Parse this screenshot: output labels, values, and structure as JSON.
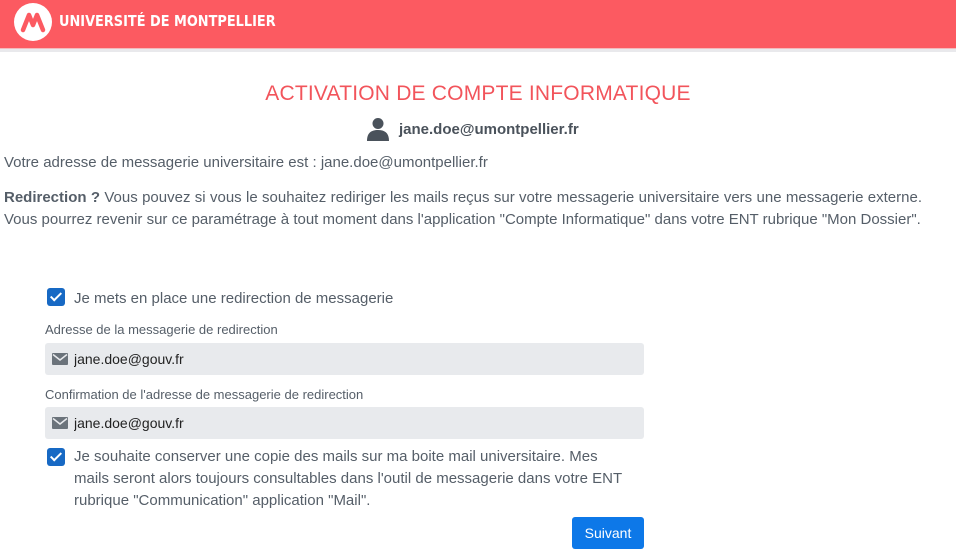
{
  "header": {
    "brand": "UNIVERSITÉ DE MONTPELLIER",
    "logo_icon": "um-logo-icon",
    "background": "#fc5a61"
  },
  "page": {
    "title": "ACTIVATION DE COMPTE INFORMATIQUE",
    "user_icon": "user-icon",
    "user_email": "jane.doe@umontpellier.fr",
    "mailbox_line": "Votre adresse de messagerie universitaire est : jane.doe@umontpellier.fr",
    "redirection_heading": "Redirection ?",
    "redirection_text": " Vous pouvez si vous le souhaitez rediriger les mails reçus sur votre messagerie universitaire vers une messagerie externe. Vous pourrez revenir sur ce paramétrage à tout moment dans l'application \"Compte Informatique\" dans votre ENT rubrique \"Mon Dossier\"."
  },
  "form": {
    "redirect_checkbox": {
      "checked": true,
      "label": "Je mets en place une redirection de messagerie"
    },
    "redirect_address": {
      "label": "Adresse de la messagerie de redirection",
      "value": "jane.doe@gouv.fr",
      "icon": "envelope-icon"
    },
    "redirect_confirm": {
      "label": "Confirmation de l'adresse de messagerie de redirection",
      "value": "jane.doe@gouv.fr",
      "icon": "envelope-icon"
    },
    "keep_copy_checkbox": {
      "checked": true,
      "label": "Je souhaite conserver une copie des mails sur ma boite mail universitaire. Mes mails seront alors toujours consultables dans l'outil de messagerie dans votre ENT rubrique \"Communication\" application \"Mail\"."
    },
    "next_button": "Suivant"
  },
  "colors": {
    "accent": "#fc5a61",
    "title": "#f2545b",
    "checkbox": "#1769c4",
    "button": "#0d78e8",
    "field_bg": "#e8eaed"
  }
}
